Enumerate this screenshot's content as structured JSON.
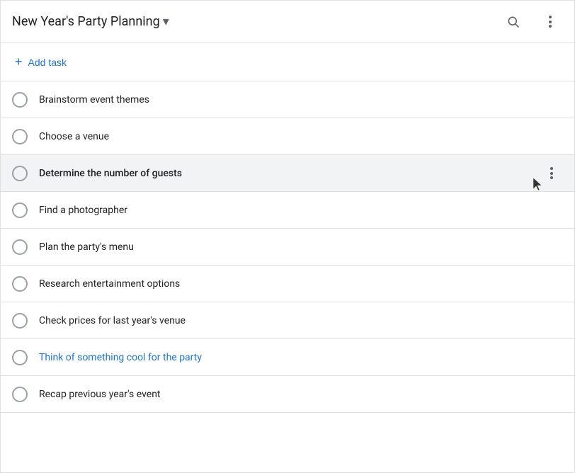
{
  "header": {
    "title": "New Year's Party Planning",
    "dropdown_label": "▾",
    "search_icon": "search-icon",
    "more_icon": "more-vert-icon"
  },
  "add_task": {
    "plus_label": "+",
    "label": "Add task"
  },
  "tasks": [
    {
      "id": 1,
      "text": "Brainstorm event themes",
      "highlighted": false,
      "blue_text": false
    },
    {
      "id": 2,
      "text": "Choose a venue",
      "highlighted": false,
      "blue_text": false
    },
    {
      "id": 3,
      "text": "Determine the number of guests",
      "highlighted": true,
      "blue_text": false
    },
    {
      "id": 4,
      "text": "Find a photographer",
      "highlighted": false,
      "blue_text": false
    },
    {
      "id": 5,
      "text": "Plan the party's menu",
      "highlighted": false,
      "blue_text": false
    },
    {
      "id": 6,
      "text": "Research entertainment options",
      "highlighted": false,
      "blue_text": false
    },
    {
      "id": 7,
      "text": "Check prices for last year's venue",
      "highlighted": false,
      "blue_text": false
    },
    {
      "id": 8,
      "text": "Think of something cool for the party",
      "highlighted": false,
      "blue_text": true
    },
    {
      "id": 9,
      "text": "Recap previous year's event",
      "highlighted": false,
      "blue_text": false
    }
  ],
  "colors": {
    "blue": "#1a73e8",
    "text_primary": "#202124",
    "text_secondary": "#5f6368",
    "border": "#e0e0e0",
    "highlight_bg": "#f1f3f4"
  }
}
